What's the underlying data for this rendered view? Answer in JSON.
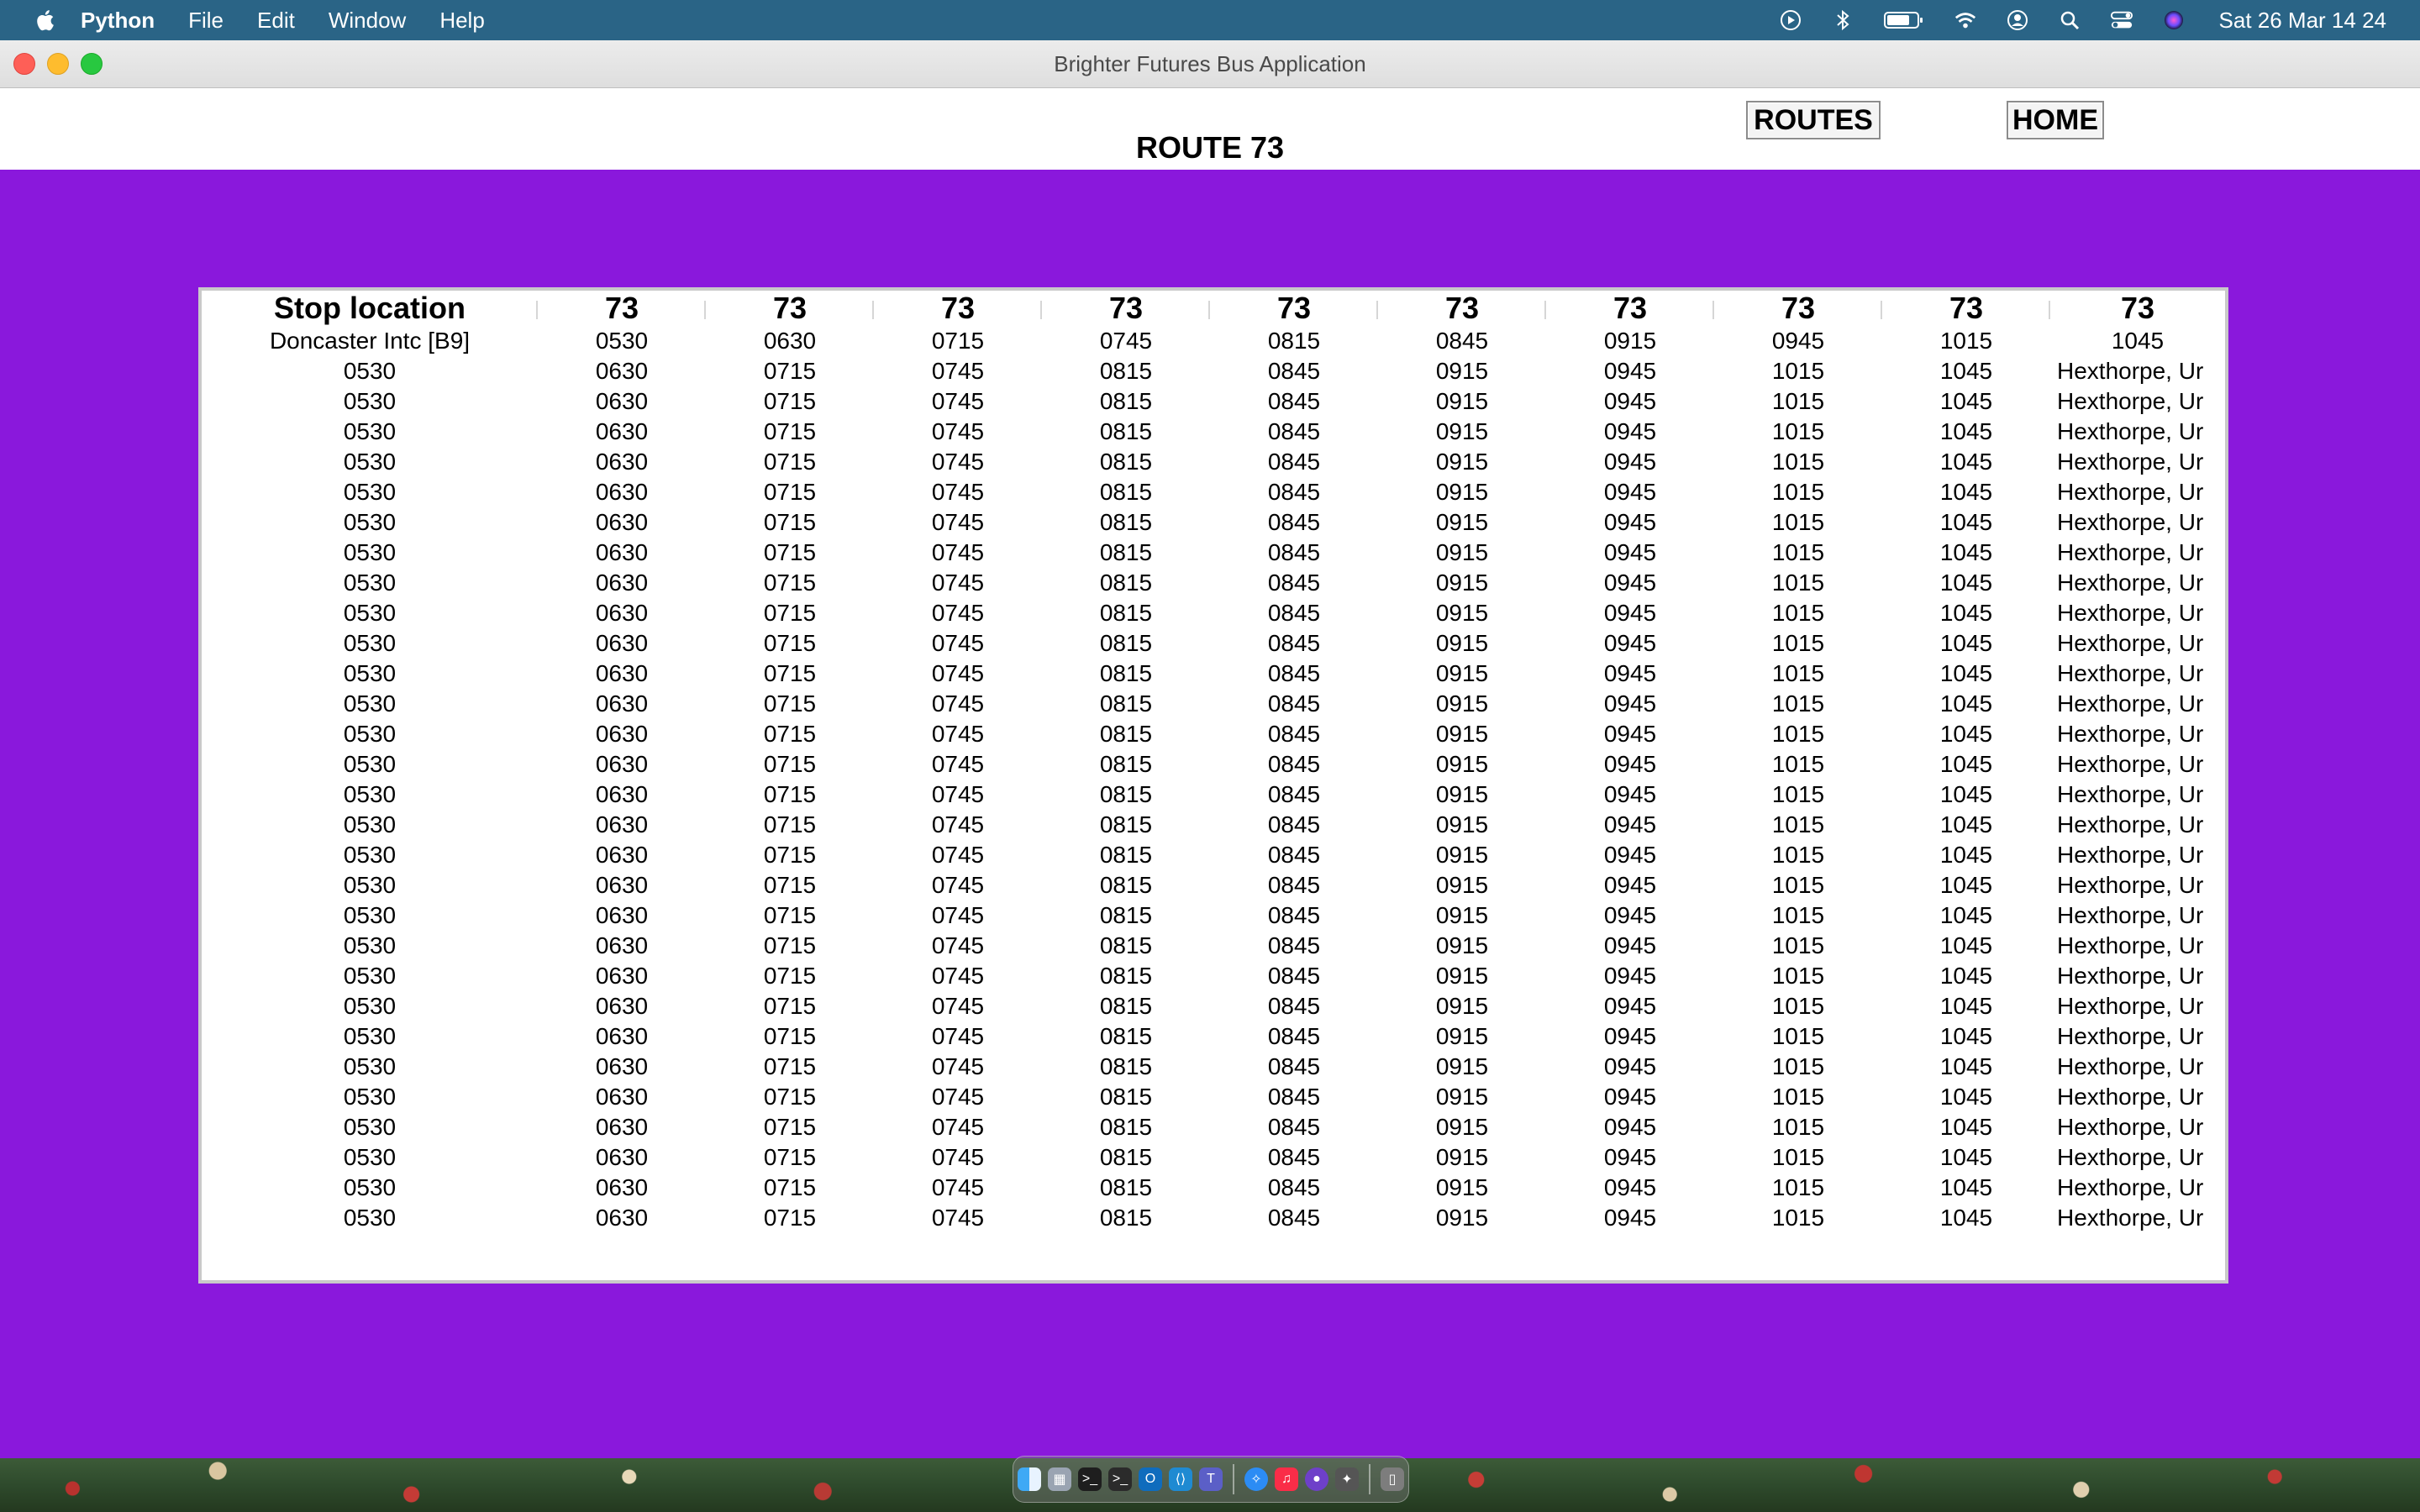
{
  "menubar": {
    "app_name": "Python",
    "menus": [
      "File",
      "Edit",
      "Window",
      "Help"
    ],
    "clock": "Sat 26 Mar  14 24",
    "status_icons": [
      "play-circle-icon",
      "bluetooth-icon",
      "battery-icon",
      "wifi-icon",
      "user-icon",
      "search-icon",
      "control-center-icon",
      "siri-icon"
    ]
  },
  "window": {
    "title": "Brighter Futures Bus Application"
  },
  "header": {
    "route_title": "ROUTE 73",
    "routes_button": "ROUTES",
    "home_button": "HOME"
  },
  "colors": {
    "window_background": "#8a18dc",
    "menubar_background": "#2a6486"
  },
  "table": {
    "headers": [
      "Stop location",
      "73",
      "73",
      "73",
      "73",
      "73",
      "73",
      "73",
      "73",
      "73",
      "73"
    ],
    "first_row": [
      "Doncaster Intc [B9]",
      "0530",
      "0630",
      "0715",
      "0745",
      "0815",
      "0845",
      "0915",
      "0945",
      "1015",
      "1045"
    ],
    "repeated_row": [
      "0530",
      "0630",
      "0715",
      "0745",
      "0815",
      "0845",
      "0915",
      "0945",
      "1015",
      "1045",
      "Hexthorpe, Ur"
    ],
    "repeated_row_count": 29
  },
  "dock": {
    "apps": [
      "finder-icon",
      "launchpad-icon",
      "terminal-icon",
      "terminal-icon",
      "outlook-icon",
      "vscode-icon",
      "teams-icon",
      "safari-icon",
      "music-icon",
      "github-icon",
      "python-icon",
      "trash-icon"
    ]
  }
}
